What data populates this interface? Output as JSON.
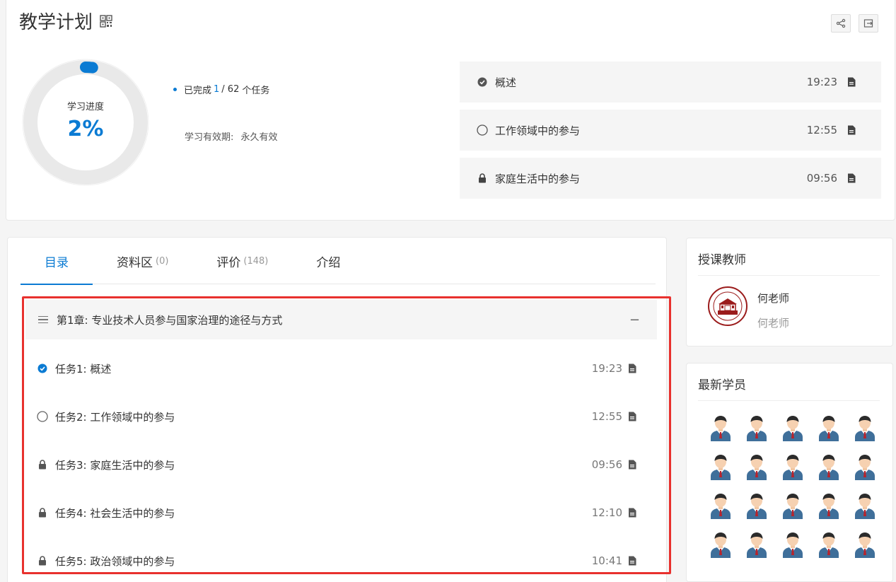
{
  "header": {
    "title": "教学计划"
  },
  "toolbar": {
    "share_icon": "share-icon",
    "exit_icon": "exit-icon"
  },
  "progress": {
    "label": "学习进度",
    "percent_text": "2%",
    "percent": 2,
    "completed_prefix": "已完成",
    "completed": "1",
    "total_text": "/ 62",
    "completed_suffix": "个任务",
    "validity_label": "学习有效期:",
    "validity_value": "永久有效"
  },
  "recent_tasks": [
    {
      "status_icon": "check-circle-icon",
      "title": "概述",
      "time": "19:23"
    },
    {
      "status_icon": "empty-circle-icon",
      "title": "工作领域中的参与",
      "time": "12:55"
    },
    {
      "status_icon": "lock-icon",
      "title": "家庭生活中的参与",
      "time": "09:56"
    }
  ],
  "tabs": [
    {
      "label": "目录",
      "count": ""
    },
    {
      "label": "资料区",
      "count": "(0)"
    },
    {
      "label": "评价",
      "count": "(148)"
    },
    {
      "label": "介绍",
      "count": ""
    }
  ],
  "chapter": {
    "title": "第1章: 专业技术人员参与国家治理的途径与方式",
    "collapse_label": "−"
  },
  "tasks": [
    {
      "status_icon": "check-circle-icon",
      "title": "任务1:  概述",
      "time": "19:23"
    },
    {
      "status_icon": "empty-circle-icon",
      "title": "任务2:  工作领域中的参与",
      "time": "12:55"
    },
    {
      "status_icon": "lock-icon",
      "title": "任务3:  家庭生活中的参与",
      "time": "09:56"
    },
    {
      "status_icon": "lock-icon",
      "title": "任务4:  社会生活中的参与",
      "time": "12:10"
    },
    {
      "status_icon": "lock-icon",
      "title": "任务5:  政治领域中的参与",
      "time": "10:41"
    }
  ],
  "teacher_panel": {
    "title": "授课教师",
    "name": "何老师",
    "subtitle": "何老师"
  },
  "students_panel": {
    "title": "最新学员",
    "count": 20
  },
  "colors": {
    "accent": "#0b7bd3",
    "highlight_border": "#e8312e"
  }
}
